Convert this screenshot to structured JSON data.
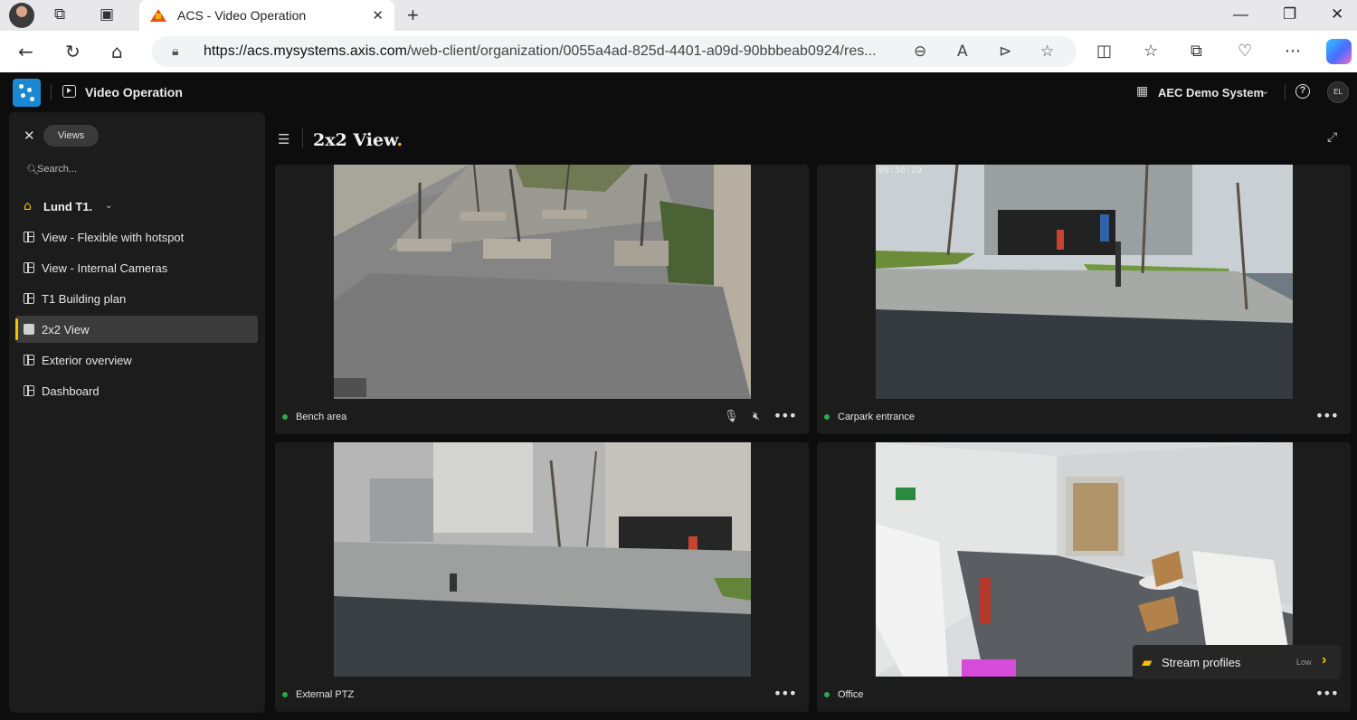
{
  "browser": {
    "tab_title": "ACS - Video Operation",
    "url_host": "https://acs.mysystems.axis.com",
    "url_path": "/web-client/organization/0055a4ad-825d-4401-a09d-90bbbeab0924/res..."
  },
  "app": {
    "title": "Video Operation",
    "system_name": "AEC Demo System",
    "user_initials": "EL"
  },
  "sidebar": {
    "chip_label": "Views",
    "search_placeholder": "Search...",
    "site_name": "Lund T1.",
    "items": [
      {
        "label": "View - Flexible with hotspot"
      },
      {
        "label": "View - Internal Cameras"
      },
      {
        "label": "T1 Building plan"
      },
      {
        "label": "2x2 View"
      },
      {
        "label": "Exterior overview"
      },
      {
        "label": "Dashboard"
      }
    ]
  },
  "main": {
    "view_title": "2x2 View",
    "view_title_dot": ".",
    "tiles": [
      {
        "camera": "Bench area"
      },
      {
        "camera": "Carpark entrance",
        "timestamp": "09:36:29"
      },
      {
        "camera": "External PTZ"
      },
      {
        "camera": "Office"
      }
    ],
    "stream_profiles": {
      "label": "Stream profiles",
      "value": "Low"
    }
  },
  "colors": {
    "accent": "#f5c400",
    "live": "#2ea84a",
    "brand": "#1a89d2"
  }
}
